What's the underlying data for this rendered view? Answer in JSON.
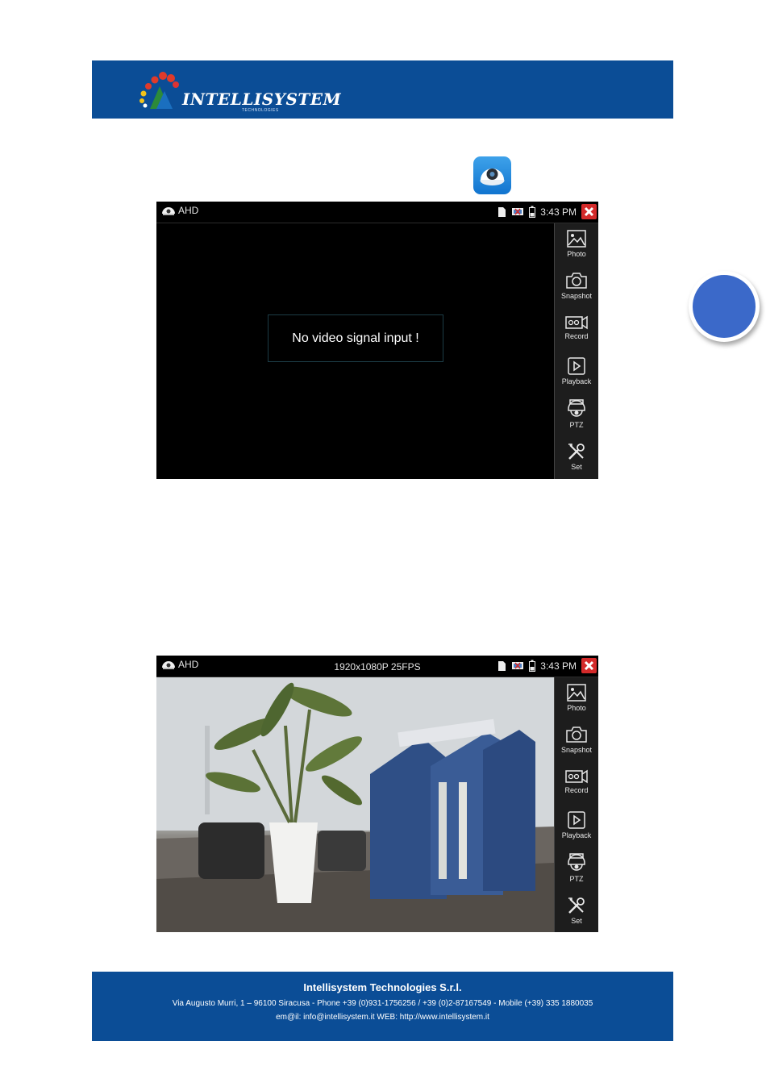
{
  "header": {
    "logo_text": "INTELLISYSTEM",
    "logo_sub": "TECHNOLOGIES"
  },
  "screens": [
    {
      "app_label": "AHD",
      "resolution": "",
      "time": "3:43 PM",
      "message": "No video signal input  !",
      "sidebar": [
        {
          "icon": "photo-icon",
          "label": "Photo"
        },
        {
          "icon": "camera-icon",
          "label": "Snapshot"
        },
        {
          "icon": "video-camera-icon",
          "label": "Record"
        },
        {
          "icon": "play-icon",
          "label": "Playback"
        },
        {
          "icon": "ptz-dome-icon",
          "label": "PTZ"
        },
        {
          "icon": "tools-icon",
          "label": "Set"
        }
      ]
    },
    {
      "app_label": "AHD",
      "resolution": "1920x1080P 25FPS",
      "time": "3:43 PM",
      "sidebar": [
        {
          "icon": "photo-icon",
          "label": "Photo"
        },
        {
          "icon": "camera-icon",
          "label": "Snapshot"
        },
        {
          "icon": "video-camera-icon",
          "label": "Record"
        },
        {
          "icon": "play-icon",
          "label": "Playback"
        },
        {
          "icon": "ptz-dome-icon",
          "label": "PTZ"
        },
        {
          "icon": "tools-icon",
          "label": "Set"
        }
      ]
    }
  ],
  "footer": {
    "company": "Intellisystem Technologies S.r.l.",
    "address": "Via Augusto Murri, 1 – 96100 Siracusa - Phone +39 (0)931-1756256 / +39 (0)2-87167549 - Mobile (+39) 335 1880035",
    "contact": "em@il: info@intellisystem.it WEB: http://www.intellisystem.it"
  },
  "colors": {
    "banner": "#0b4d96",
    "badge": "#3b69c9",
    "close": "#d42a2a"
  }
}
